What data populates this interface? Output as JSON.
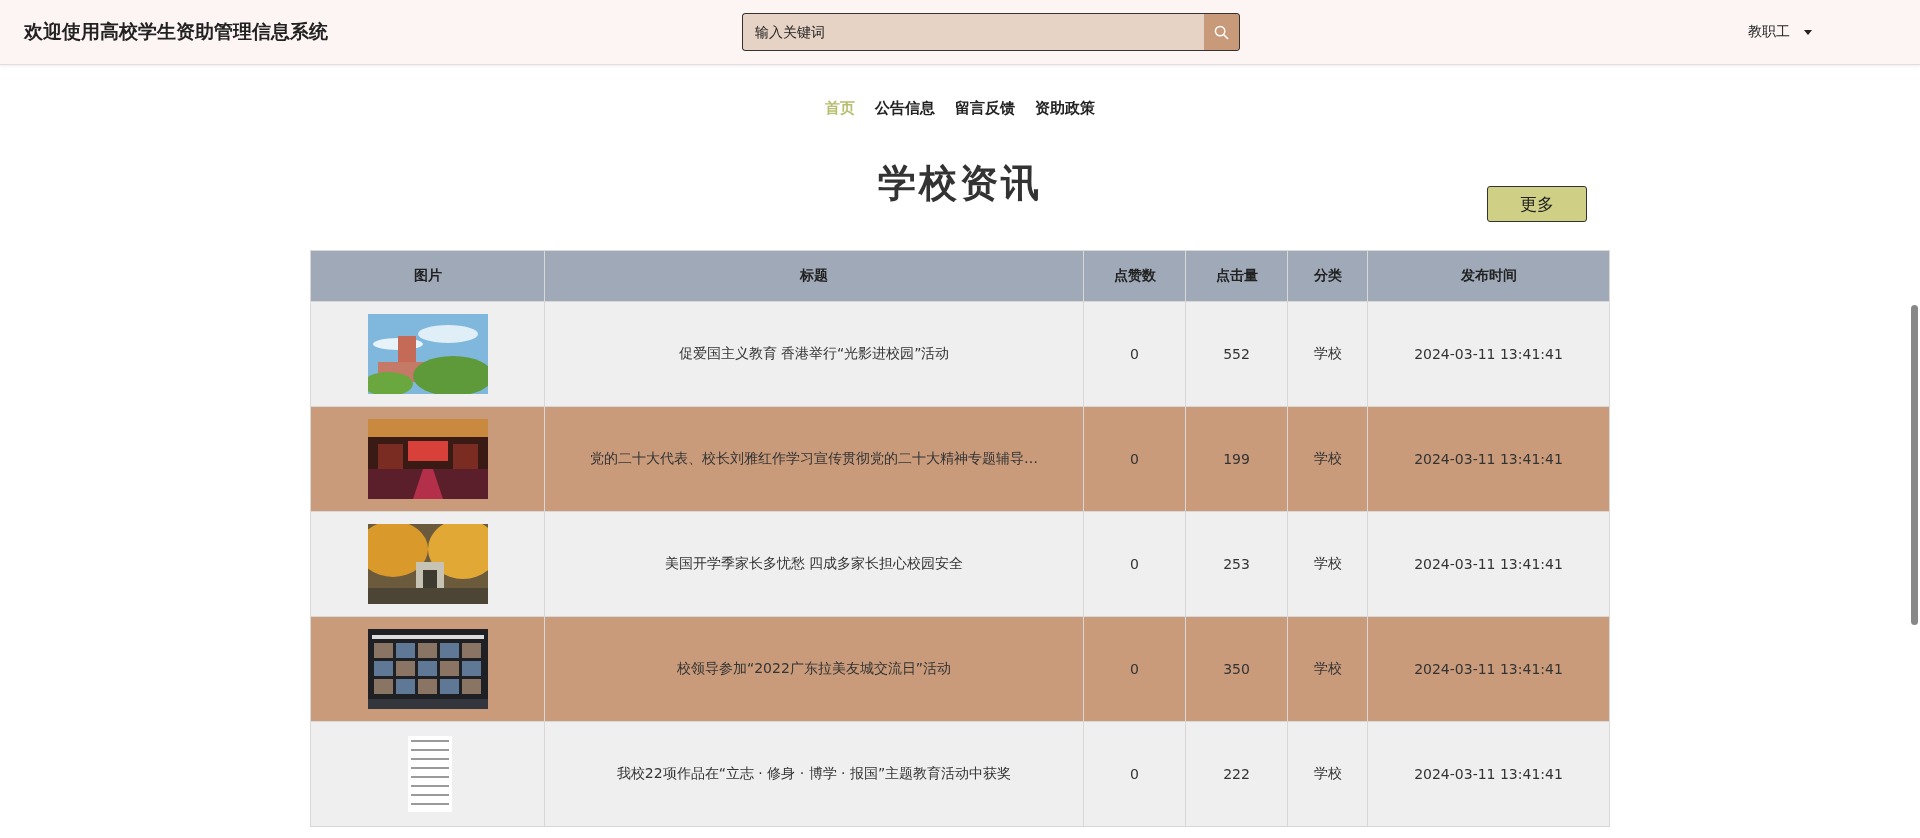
{
  "header": {
    "title": "欢迎使用高校学生资助管理信息系统",
    "search": {
      "placeholder": "输入关键词"
    },
    "user_menu": "教职工"
  },
  "nav": [
    {
      "label": "首页",
      "selected": true
    },
    {
      "label": "公告信息",
      "selected": false
    },
    {
      "label": "留言反馈",
      "selected": false
    },
    {
      "label": "资助政策",
      "selected": false
    }
  ],
  "section": {
    "title": "学校资讯",
    "more_button": "更多"
  },
  "table": {
    "columns": [
      "图片",
      "标题",
      "点赞数",
      "点击量",
      "分类",
      "发布时间"
    ],
    "rows": [
      {
        "title": "促爱国主义教育 香港举行“光影进校园”活动",
        "likes": "0",
        "clicks": "552",
        "category": "学校",
        "time": "2024-03-11 13:41:41"
      },
      {
        "title": "党的二十大代表、校长刘雅红作学习宣传贯彻党的二十大精神专题辅导…",
        "likes": "0",
        "clicks": "199",
        "category": "学校",
        "time": "2024-03-11 13:41:41"
      },
      {
        "title": "美国开学季家长多忧愁 四成多家长担心校园安全",
        "likes": "0",
        "clicks": "253",
        "category": "学校",
        "time": "2024-03-11 13:41:41"
      },
      {
        "title": "校领导参加“2022广东拉美友城交流日”活动",
        "likes": "0",
        "clicks": "350",
        "category": "学校",
        "time": "2024-03-11 13:41:41"
      },
      {
        "title": "我校22项作品在“立志 · 修身 · 博学 · 报国”主题教育活动中获奖",
        "likes": "0",
        "clicks": "222",
        "category": "学校",
        "time": "2024-03-11 13:41:41"
      }
    ]
  }
}
